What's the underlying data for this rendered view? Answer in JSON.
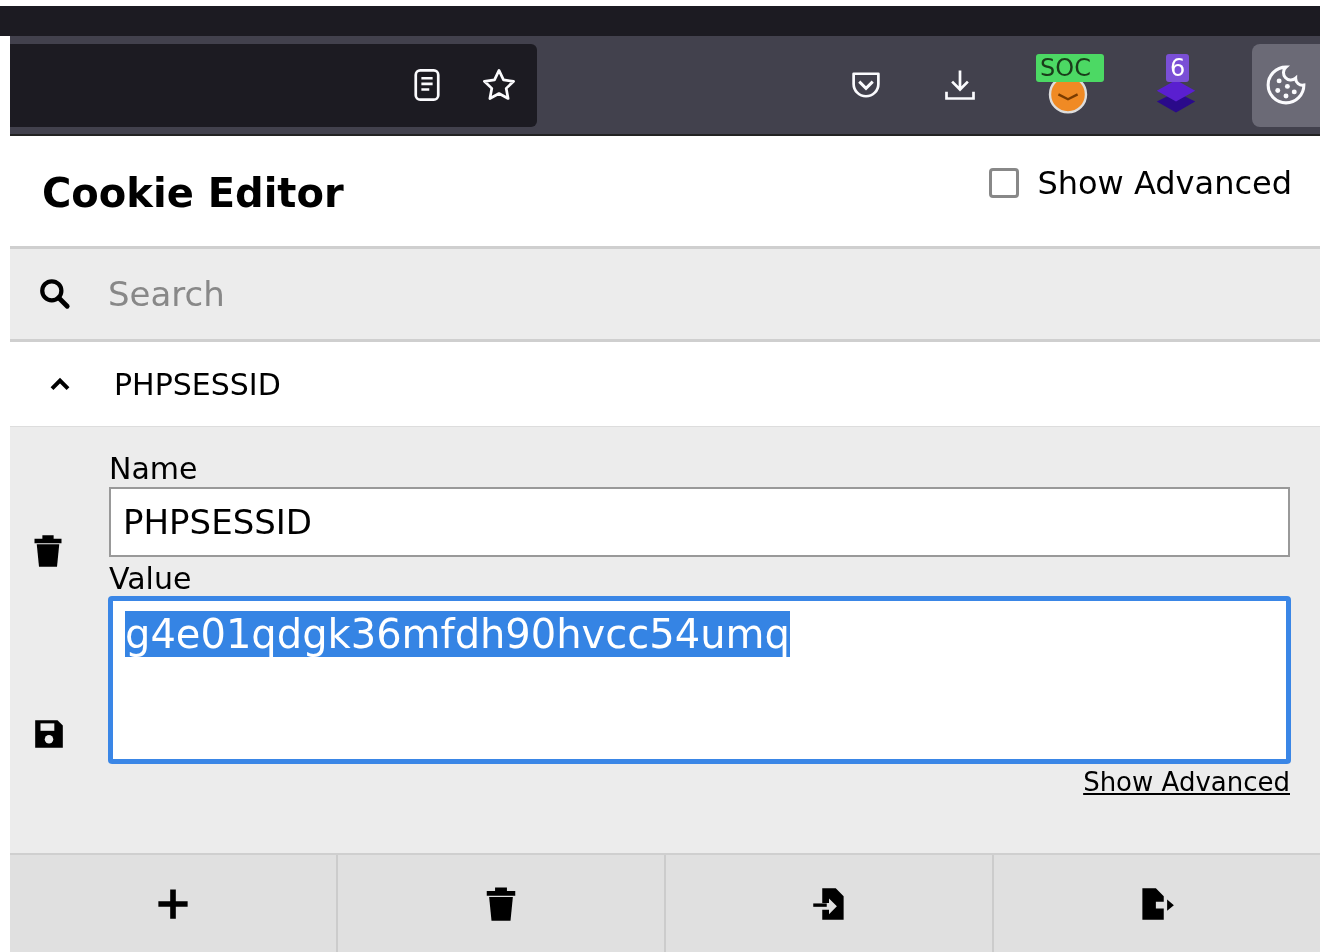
{
  "toolbar": {
    "extensions": [
      {
        "kind": "reader"
      },
      {
        "kind": "star"
      }
    ],
    "actions": [
      {
        "kind": "pocket"
      },
      {
        "kind": "download"
      },
      {
        "kind": "sock",
        "badge": "SOC"
      },
      {
        "kind": "layers",
        "badge": "6"
      },
      {
        "kind": "cookie",
        "selected": true
      }
    ]
  },
  "panel": {
    "title": "Cookie Editor",
    "show_advanced": {
      "label": "Show Advanced",
      "checked": false
    },
    "search": {
      "placeholder": "Search"
    },
    "cookies": [
      {
        "name": "PHPSESSID",
        "expanded": true,
        "name_label": "Name",
        "name_value": "PHPSESSID",
        "value_label": "Value",
        "value": "g4e01qdgk36mfdh90hvcc54umq",
        "value_selected": true,
        "link": "Show Advanced"
      }
    ],
    "buttons": [
      {
        "kind": "add"
      },
      {
        "kind": "delete"
      },
      {
        "kind": "import"
      },
      {
        "kind": "export"
      }
    ]
  }
}
